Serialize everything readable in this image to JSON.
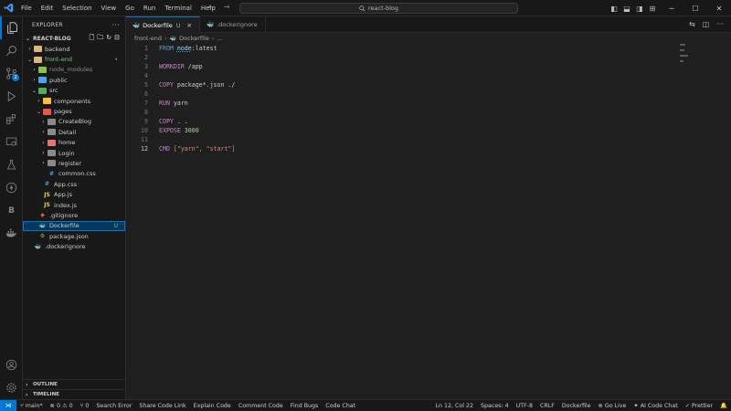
{
  "menu": [
    "File",
    "Edit",
    "Selection",
    "View",
    "Go",
    "Run",
    "Terminal",
    "Help"
  ],
  "search": {
    "text": "react-blog"
  },
  "explorer": {
    "title": "EXPLORER",
    "project": "REACT-BLOG",
    "tree": [
      {
        "label": "backend",
        "depth": 1,
        "kind": "folder",
        "open": false,
        "color": "#dcb67a"
      },
      {
        "label": "front-end",
        "depth": 1,
        "kind": "folder",
        "open": true,
        "color": "#dcb67a",
        "status": "•",
        "status_color": "#73c991",
        "label_color": "#73c991"
      },
      {
        "label": "node_modules",
        "depth": 2,
        "kind": "folder",
        "open": false,
        "color": "#8bc34a",
        "label_color": "#8b8b8b"
      },
      {
        "label": "public",
        "depth": 2,
        "kind": "folder",
        "open": false,
        "color": "#42a5f5"
      },
      {
        "label": "src",
        "depth": 2,
        "kind": "folder",
        "open": true,
        "color": "#4caf50"
      },
      {
        "label": "components",
        "depth": 3,
        "kind": "folder",
        "open": false,
        "color": "#fbc02d"
      },
      {
        "label": "pages",
        "depth": 3,
        "kind": "folder",
        "open": true,
        "color": "#ef5350"
      },
      {
        "label": "CreateBlog",
        "depth": 4,
        "kind": "folder",
        "open": false,
        "color": "#8a8a8a"
      },
      {
        "label": "Detail",
        "depth": 4,
        "kind": "folder",
        "open": false,
        "color": "#8a8a8a"
      },
      {
        "label": "home",
        "depth": 4,
        "kind": "folder",
        "open": false,
        "color": "#e57373"
      },
      {
        "label": "Login",
        "depth": 4,
        "kind": "folder",
        "open": false,
        "color": "#8a8a8a"
      },
      {
        "label": "register",
        "depth": 4,
        "kind": "folder",
        "open": false,
        "color": "#8a8a8a"
      },
      {
        "label": "common.css",
        "depth": 4,
        "kind": "file",
        "icon": "#42a5f5",
        "glyph": "#"
      },
      {
        "label": "App.css",
        "depth": 3,
        "kind": "file",
        "icon": "#42a5f5",
        "glyph": "#"
      },
      {
        "label": "App.js",
        "depth": 3,
        "kind": "file",
        "icon": "#e8d44d",
        "glyph": "JS"
      },
      {
        "label": "index.js",
        "depth": 3,
        "kind": "file",
        "icon": "#e8d44d",
        "glyph": "JS"
      },
      {
        "label": ".gitignore",
        "depth": 2,
        "kind": "file",
        "icon": "#f05033",
        "glyph": "◆"
      },
      {
        "label": "Dockerfile",
        "depth": 2,
        "kind": "file",
        "icon": "#2496ed",
        "glyph": "🐳",
        "selected": true,
        "status": "U",
        "status_color": "#73c991"
      },
      {
        "label": "package.json",
        "depth": 2,
        "kind": "file",
        "icon": "#8bc34a",
        "glyph": "⚙"
      },
      {
        "label": ".dockerignore",
        "depth": 1,
        "kind": "file",
        "icon": "#2496ed",
        "glyph": "🐳"
      }
    ],
    "outline": "OUTLINE",
    "timeline": "TIMELINE"
  },
  "tabs": [
    {
      "label": "Dockerfile",
      "modified": "U",
      "active": true
    },
    {
      "label": ".dockerignore",
      "active": false
    }
  ],
  "breadcrumb": {
    "folder": "front-end",
    "file": "Dockerfile",
    "more": "..."
  },
  "code": [
    {
      "n": "1",
      "parts": [
        [
          "kw",
          "FROM "
        ],
        [
          "und",
          "node"
        ],
        [
          "txt",
          ":latest"
        ]
      ]
    },
    {
      "n": "2",
      "parts": []
    },
    {
      "n": "3",
      "parts": [
        [
          "inst",
          "WORKDIR "
        ],
        [
          "txt",
          "/app"
        ]
      ]
    },
    {
      "n": "4",
      "parts": []
    },
    {
      "n": "5",
      "parts": [
        [
          "inst",
          "COPY "
        ],
        [
          "txt",
          "package*.json ./"
        ]
      ]
    },
    {
      "n": "6",
      "parts": []
    },
    {
      "n": "7",
      "parts": [
        [
          "inst",
          "RUN "
        ],
        [
          "txt",
          "yarn"
        ]
      ]
    },
    {
      "n": "8",
      "parts": []
    },
    {
      "n": "9",
      "parts": [
        [
          "inst",
          "COPY "
        ],
        [
          "txt",
          ". ."
        ]
      ]
    },
    {
      "n": "10",
      "parts": [
        [
          "inst",
          "EXPOSE "
        ],
        [
          "num",
          "3000"
        ]
      ]
    },
    {
      "n": "11",
      "parts": []
    },
    {
      "n": "12",
      "current": true,
      "parts": [
        [
          "inst",
          "CMD "
        ],
        [
          "str",
          "[\"yarn\", \"start\"]"
        ]
      ]
    }
  ],
  "status": {
    "branch": "main*",
    "errors": "0",
    "warnings": "0",
    "ports": "0",
    "left_items": [
      "Search Error",
      "Share Code Link",
      "Explain Code",
      "Comment Code",
      "Find Bugs",
      "Code Chat"
    ],
    "cursor": "Ln 12, Col 22",
    "spaces": "Spaces: 4",
    "encoding": "UTF-8",
    "eol": "CRLF",
    "language": "Dockerfile",
    "golive": "Go Live",
    "aichat": "AI Code Chat",
    "prettier": "Prettier"
  }
}
